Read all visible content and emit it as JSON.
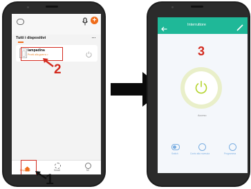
{
  "left_screen": {
    "section_title": "Tutti i dispositivi",
    "more_icon": "more-dots-icon",
    "device": {
      "name": "lampadina",
      "subtitle": "Pronti alla guerra >",
      "icon": "light-switch-icon",
      "power_icon": "power-icon"
    },
    "tabs": [
      {
        "label": "Dispositivi",
        "icon": "home-icon"
      },
      {
        "label": "Smart",
        "icon": "smart-icon"
      },
      {
        "label": "Mi",
        "icon": "profile-icon"
      }
    ],
    "header_icons": [
      "chat-icon",
      "microphone-icon",
      "add-icon"
    ]
  },
  "right_screen": {
    "title": "Interruttore",
    "back_icon": "back-arrow-icon",
    "edit_icon": "edit-pencil-icon",
    "state_label": "Acceso",
    "actions": [
      {
        "label": "Switch",
        "icon": "toggle-icon"
      },
      {
        "label": "Conto alla rovescia",
        "icon": "countdown-icon"
      },
      {
        "label": "Programma",
        "icon": "schedule-icon"
      }
    ],
    "colors": {
      "header": "#1fb898",
      "accent": "#b3d32a",
      "ring": "#e9efc9",
      "action": "#7aaee2"
    }
  },
  "annotations": {
    "step1": "1",
    "step2": "2",
    "step3": "3"
  }
}
